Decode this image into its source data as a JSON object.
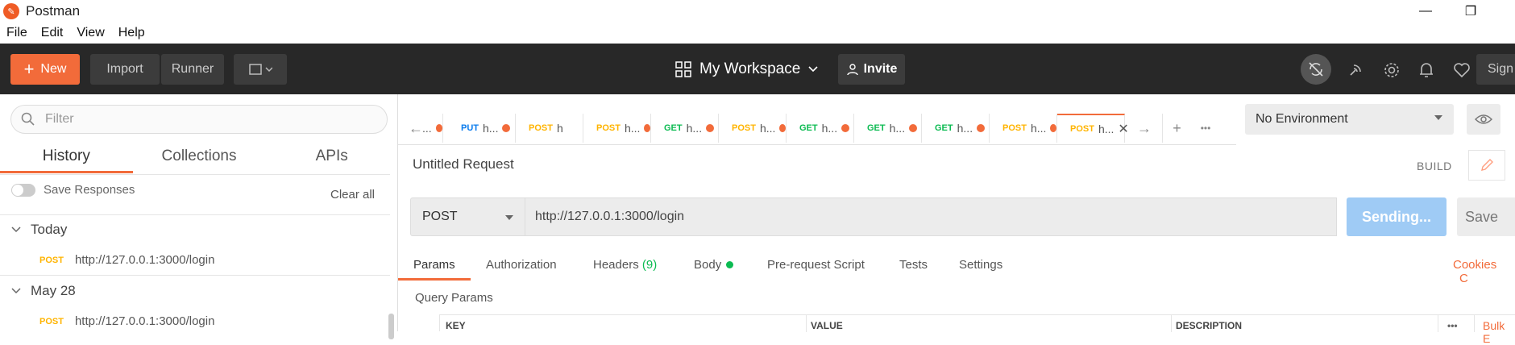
{
  "titlebar": {
    "title": "Postman",
    "minimize": "—",
    "restore": "❐"
  },
  "menu": [
    "File",
    "Edit",
    "View",
    "Help"
  ],
  "header": {
    "new_label": "New",
    "import_label": "Import",
    "runner_label": "Runner",
    "workspace_label": "My Workspace",
    "invite_label": "Invite",
    "signin_label": "Sign"
  },
  "sidebar": {
    "filter_placeholder": "Filter",
    "tabs": [
      "History",
      "Collections",
      "APIs"
    ],
    "save_responses_label": "Save Responses",
    "clear_all_label": "Clear all",
    "groups": [
      {
        "label": "Today",
        "items": [
          {
            "method": "POST",
            "url": "http://127.0.0.1:3000/login"
          }
        ]
      },
      {
        "label": "May 28",
        "items": [
          {
            "method": "POST",
            "url": "http://127.0.0.1:3000/login"
          }
        ]
      }
    ]
  },
  "request_tabs": [
    {
      "method": "",
      "name": "..."
    },
    {
      "method": "PUT",
      "name": "h..."
    },
    {
      "method": "POST",
      "name": "h"
    },
    {
      "method": "POST",
      "name": "h..."
    },
    {
      "method": "GET",
      "name": "h..."
    },
    {
      "method": "POST",
      "name": "h..."
    },
    {
      "method": "GET",
      "name": "h..."
    },
    {
      "method": "GET",
      "name": "h..."
    },
    {
      "method": "GET",
      "name": "h..."
    },
    {
      "method": "POST",
      "name": "h..."
    },
    {
      "method": "POST",
      "name": "h..."
    }
  ],
  "environment": {
    "selected": "No Environment"
  },
  "request": {
    "title": "Untitled Request",
    "build_label": "BUILD",
    "method": "POST",
    "url": "http://127.0.0.1:3000/login",
    "send_label": "Sending...",
    "save_label": "Save"
  },
  "request_subtabs": [
    "Params",
    "Authorization",
    "Headers",
    "Body",
    "Pre-request Script",
    "Tests",
    "Settings"
  ],
  "headers_count": "(9)",
  "cookies_label": "Cookies",
  "cookies_cut": "C",
  "query_params": {
    "title": "Query Params",
    "columns": [
      "KEY",
      "VALUE",
      "DESCRIPTION"
    ],
    "bulk_label": "Bulk E",
    "more": "•••"
  },
  "colors": {
    "accent": "#f26b3a",
    "dark_bar": "#282828",
    "send_blue": "#9fcbf5",
    "post": "#ffb400",
    "get": "#0cbb52",
    "put": "#097bed"
  }
}
